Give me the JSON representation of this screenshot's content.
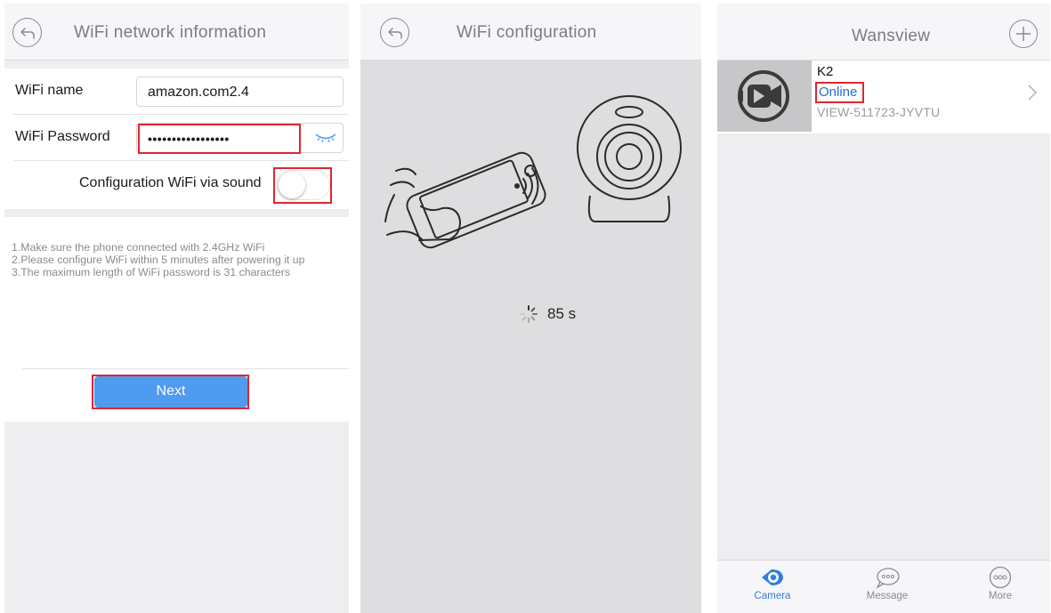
{
  "screens": {
    "wifi_info": {
      "title": "WiFi network information",
      "wifi_name_label": "WiFi name",
      "wifi_name_value": "amazon.com2.4",
      "wifi_password_label": "WiFi Password",
      "wifi_password_value": "•••••••••••••••••",
      "sound_label": "Configuration WiFi via sound",
      "sound_enabled": false,
      "hints": [
        "1.Make sure the phone connected with 2.4GHz WiFi",
        "2.Please configure WiFi within 5 minutes after powering it up",
        "3.The maximum length of WiFi password is 31 characters"
      ],
      "next_label": "Next"
    },
    "wifi_config": {
      "title": "WiFi configuration",
      "countdown": "85 s"
    },
    "device_list": {
      "title": "Wansview",
      "devices": [
        {
          "name": "K2",
          "status": "Online",
          "id": "VIEW-511723-JYVTU"
        }
      ],
      "tabs": [
        {
          "label": "Camera",
          "icon": "camera-eye-icon",
          "active": true
        },
        {
          "label": "Message",
          "icon": "message-bubble-icon",
          "active": false
        },
        {
          "label": "More",
          "icon": "more-dots-icon",
          "active": false
        }
      ]
    }
  },
  "colors": {
    "highlight": "#e0252f",
    "accent": "#4f9bf0",
    "online": "#2a6bd0",
    "tab_active": "#2f7fe0"
  }
}
